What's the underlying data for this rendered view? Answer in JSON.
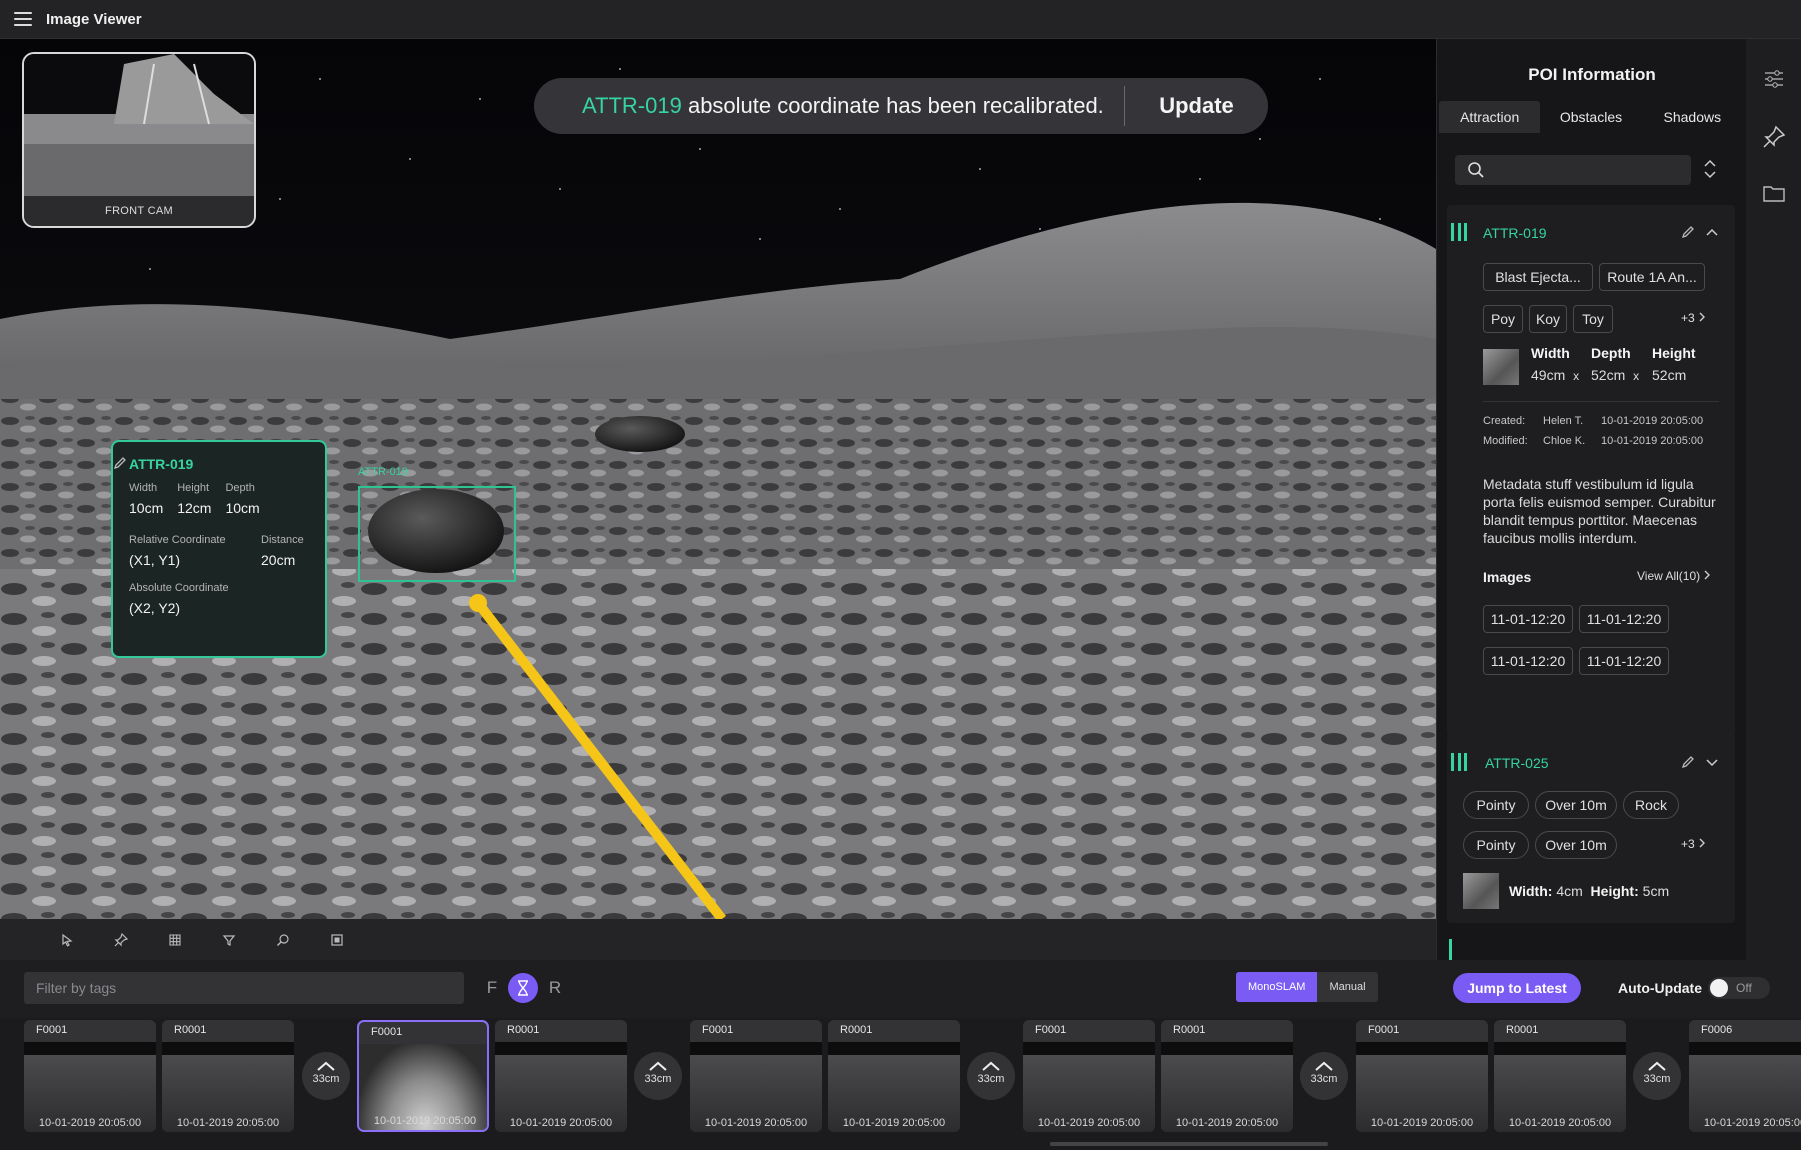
{
  "app": {
    "title": "Image Viewer"
  },
  "minimap": {
    "caption": "FRONT CAM"
  },
  "toast": {
    "id": "ATTR-019",
    "message": " absolute coordinate has been recalibrated.",
    "action": "Update"
  },
  "overlay": {
    "id": "ATTR-019",
    "width_label": "Width",
    "width": "10cm",
    "height_label": "Height",
    "height": "12cm",
    "depth_label": "Depth",
    "depth": "10cm",
    "rel_label": "Relative Coordinate",
    "rel": "(X1, Y1)",
    "dist_label": "Distance",
    "dist": "20cm",
    "abs_label": "Absolute Coordinate",
    "abs": "(X2, Y2)"
  },
  "bbox_label": "ATTR-019",
  "filter": {
    "placeholder": "Filter by tags",
    "f": "F",
    "r": "R"
  },
  "mode": {
    "a": "MonoSLAM",
    "b": "Manual"
  },
  "jump": "Jump to Latest",
  "auto_update": {
    "label": "Auto-Update",
    "state": "Off"
  },
  "timeline": {
    "thumbs": [
      {
        "name": "F0001",
        "ts": "10-01-2019 20:05:00"
      },
      {
        "name": "R0001",
        "ts": "10-01-2019 20:05:00"
      },
      {
        "name": "F0001",
        "ts": "10-01-2019 20:05:00"
      },
      {
        "name": "R0001",
        "ts": "10-01-2019 20:05:00"
      },
      {
        "name": "F0001",
        "ts": "10-01-2019 20:05:00"
      },
      {
        "name": "R0001",
        "ts": "10-01-2019 20:05:00"
      },
      {
        "name": "F0001",
        "ts": "10-01-2019 20:05:00"
      },
      {
        "name": "R0001",
        "ts": "10-01-2019 20:05:00"
      },
      {
        "name": "F0001",
        "ts": "10-01-2019 20:05:00"
      },
      {
        "name": "R0001",
        "ts": "10-01-2019 20:05:00"
      },
      {
        "name": "F0006",
        "ts": "10-01-2019 20:05:00"
      }
    ],
    "gap": "33cm"
  },
  "panel": {
    "title": "POI Information",
    "tabs": [
      "Attraction",
      "Obstacles",
      "Shadows"
    ],
    "card1": {
      "id": "ATTR-019",
      "tags1": [
        "Blast Ejecta...",
        "Route 1A An..."
      ],
      "tags2": [
        "Poy",
        "Koy",
        "Toy"
      ],
      "more": "+3",
      "w_label": "Width",
      "d_label": "Depth",
      "h_label": "Height",
      "w": "49cm",
      "d": "52cm",
      "h": "52cm",
      "x": "x",
      "created_label": "Created:",
      "created_by": "Helen T.",
      "created_at": "10-01-2019 20:05:00",
      "modified_label": "Modified:",
      "modified_by": "Chloe K.",
      "modified_at": "10-01-2019 20:05:00",
      "desc": "Metadata stuff vestibulum id ligula porta felis euismod semper. Curabitur blandit tempus porttitor. Maecenas faucibus mollis interdum.",
      "images_label": "Images",
      "view_all": "View All(10)",
      "image_chips": [
        "11-01-12:20",
        "11-01-12:20",
        "11-01-12:20",
        "11-01-12:20"
      ]
    },
    "card2": {
      "id": "ATTR-025",
      "tags1": [
        "Pointy",
        "Over 10m",
        "Rock"
      ],
      "tags2": [
        "Pointy",
        "Over 10m"
      ],
      "more": "+3",
      "w_label": "Width",
      "w": "4cm",
      "h_label": "Height",
      "h": "5cm",
      "colon": ":"
    }
  },
  "colors": {
    "accent": "#36d4a0",
    "primary": "#7a5cf5",
    "path": "#f5c518"
  }
}
